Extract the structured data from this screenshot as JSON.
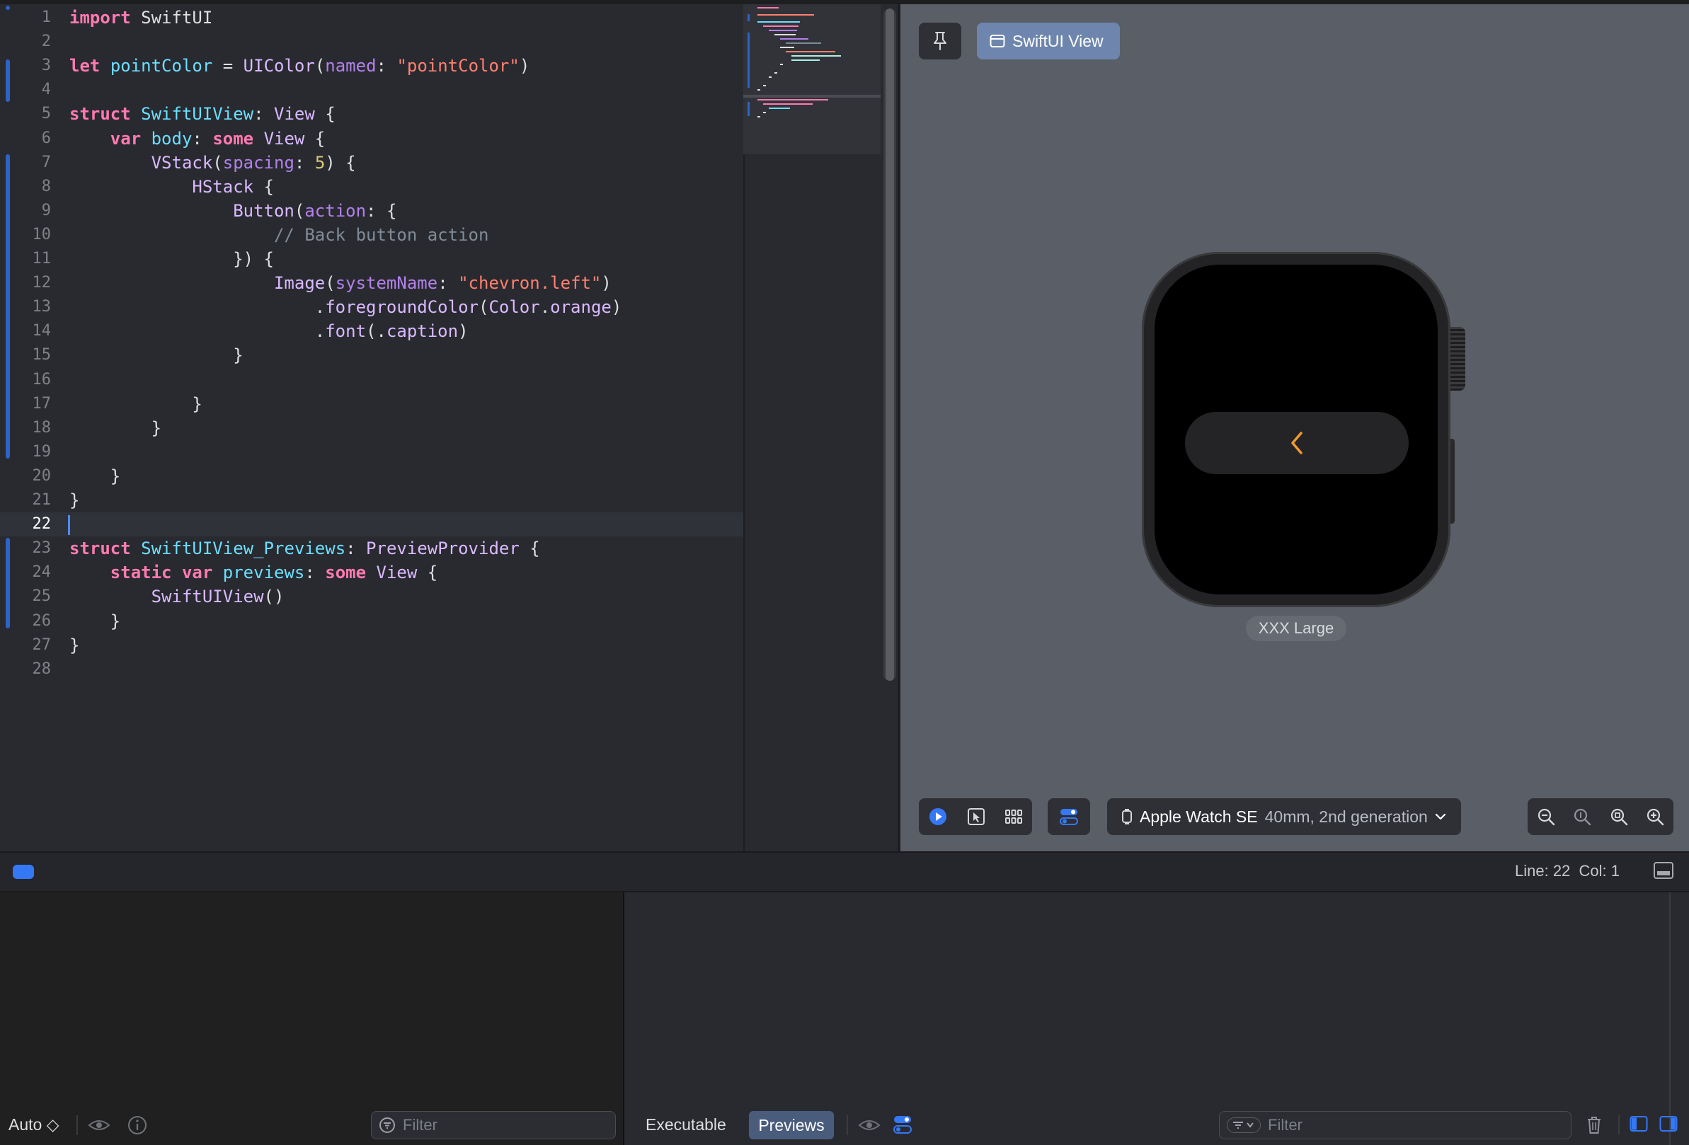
{
  "editor": {
    "lines": [
      {
        "n": "1",
        "text": "import SwiftUI"
      },
      {
        "n": "2",
        "text": ""
      },
      {
        "n": "3",
        "text": "let pointColor = UIColor(named: \"pointColor\")"
      },
      {
        "n": "4",
        "text": ""
      },
      {
        "n": "5",
        "text": "struct SwiftUIView: View {"
      },
      {
        "n": "6",
        "text": "    var body: some View {"
      },
      {
        "n": "7",
        "text": "        VStack(spacing: 5) {"
      },
      {
        "n": "8",
        "text": "            HStack {"
      },
      {
        "n": "9",
        "text": "                Button(action: {"
      },
      {
        "n": "10",
        "text": "                    // Back button action"
      },
      {
        "n": "11",
        "text": "                }) {"
      },
      {
        "n": "12",
        "text": "                    Image(systemName: \"chevron.left\")"
      },
      {
        "n": "13",
        "text": "                        .foregroundColor(Color.orange)"
      },
      {
        "n": "14",
        "text": "                        .font(.caption)"
      },
      {
        "n": "15",
        "text": "                }"
      },
      {
        "n": "16",
        "text": ""
      },
      {
        "n": "17",
        "text": "            }"
      },
      {
        "n": "18",
        "text": "        }"
      },
      {
        "n": "19",
        "text": ""
      },
      {
        "n": "20",
        "text": "    }"
      },
      {
        "n": "21",
        "text": "}"
      },
      {
        "n": "22",
        "text": ""
      },
      {
        "n": "23",
        "text": "struct SwiftUIView_Previews: PreviewProvider {"
      },
      {
        "n": "24",
        "text": "    static var previews: some View {"
      },
      {
        "n": "25",
        "text": "        SwiftUIView()"
      },
      {
        "n": "26",
        "text": "    }"
      },
      {
        "n": "27",
        "text": "}"
      },
      {
        "n": "28",
        "text": ""
      }
    ],
    "current_line": "22"
  },
  "canvas": {
    "pin_icon": "pin-icon",
    "preview_tab_label": "SwiftUI View",
    "variant_label": "XXX Large",
    "device_name": "Apple Watch SE",
    "device_detail": "40mm, 2nd generation",
    "watch_content_icon": "chevron-left-icon",
    "chevron_glyph": "‹"
  },
  "status": {
    "position": "Line: 22  Col: 1"
  },
  "debug": {
    "scheme_label": "Auto ◇",
    "filter_placeholder": "Filter",
    "console_tab_executable": "Executable",
    "console_tab_previews": "Previews",
    "console_filter_placeholder": "Filter"
  },
  "colors": {
    "accent": "#3478f6",
    "chevron": "#f29a2e",
    "keyword": "#ff7ab2",
    "string": "#ff8170"
  }
}
